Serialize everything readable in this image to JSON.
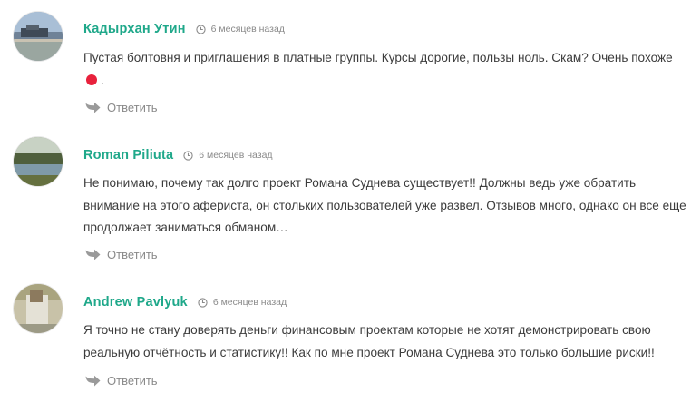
{
  "comments": [
    {
      "author": "Кадырхан Утин",
      "time": "6 месяцев назад",
      "text_before": "Пустая болтовня и приглашения в платные группы. Курсы дорогие, пользы ноль. Скам? Очень похоже",
      "text_after": ".",
      "reply_label": "Ответить"
    },
    {
      "author": "Roman Piliuta",
      "time": "6 месяцев назад",
      "text": "Не понимаю, почему так долго проект Романа Суднева существует!! Должны ведь уже обратить внимание на этого афериста, он стольких пользователей уже развел. Отзывов много, однако он все еще продолжает заниматься обманом…",
      "reply_label": "Ответить"
    },
    {
      "author": "Andrew Pavlyuk",
      "time": "6 месяцев назад",
      "text": "Я точно не стану доверять деньги финансовым проектам которые не хотят демонстрировать свою реальную отчётность и статистику!! Как по мне проект Романа Суднева это только большие риски!!",
      "reply_label": "Ответить"
    }
  ],
  "colors": {
    "author": "#1fa88a",
    "meta": "#8a8a8a",
    "text": "#3c3c3c",
    "emoji_dot": "#e8213c"
  },
  "icons": {
    "time": "clock-icon",
    "reply": "reply-arrow-icon",
    "inline_emoji": "red-circle-icon"
  }
}
